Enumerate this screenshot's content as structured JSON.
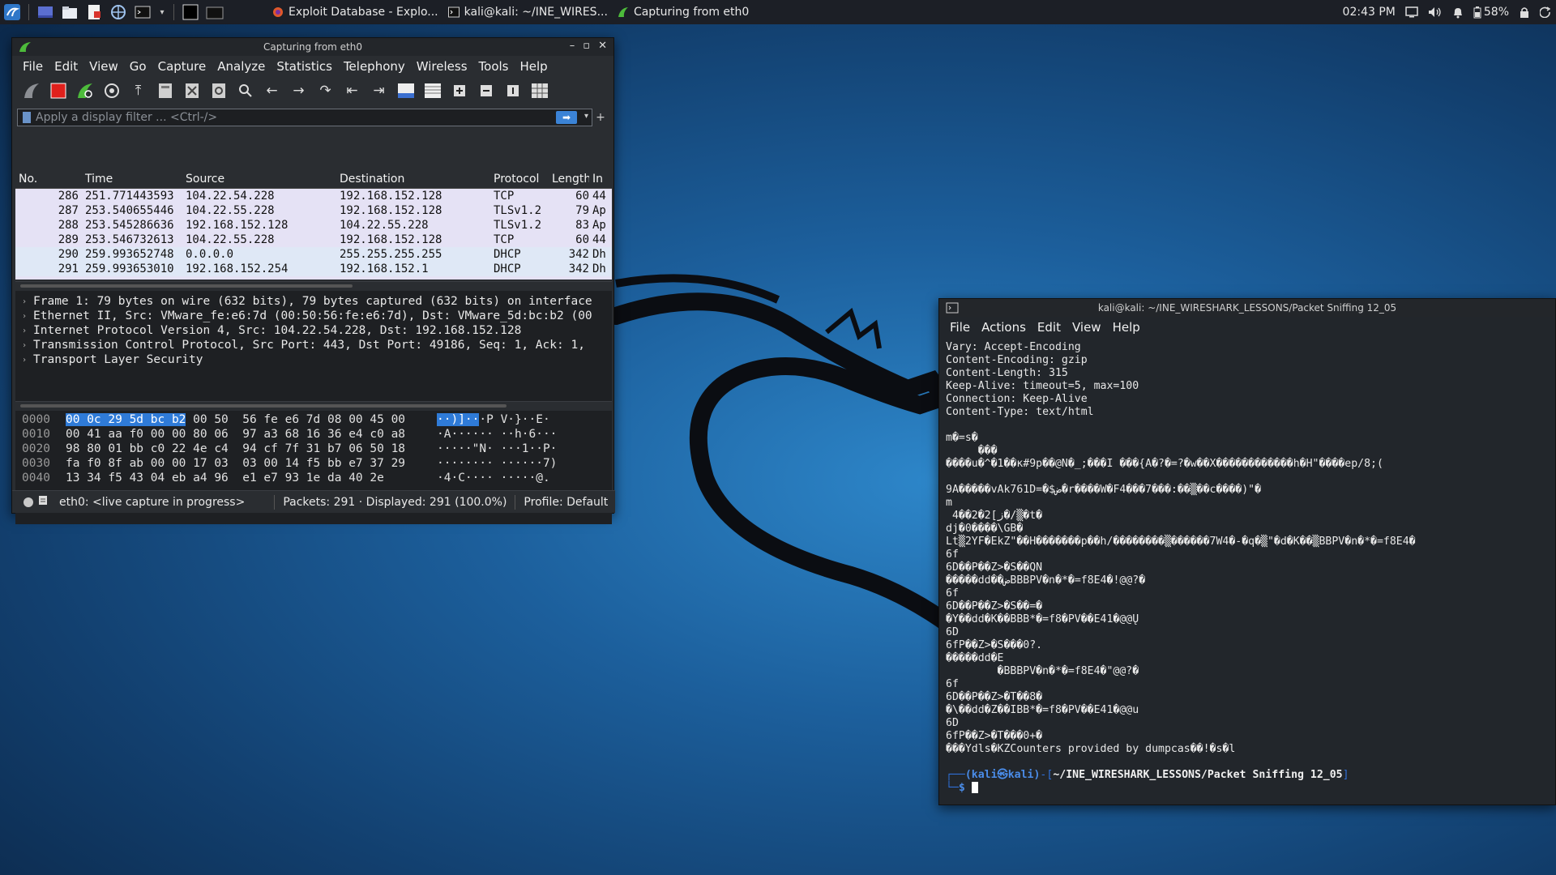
{
  "taskbar": {
    "tasks": [
      {
        "label": "Exploit Database - Explo...",
        "icon": "firefox-icon"
      },
      {
        "label": "kali@kali: ~/INE_WIRES...",
        "icon": "terminal-icon"
      },
      {
        "label": "Capturing from eth0",
        "icon": "wireshark-icon"
      }
    ],
    "clock": "02:43 PM",
    "battery": "58%"
  },
  "wireshark": {
    "title": "Capturing from eth0",
    "menu": [
      "File",
      "Edit",
      "View",
      "Go",
      "Capture",
      "Analyze",
      "Statistics",
      "Telephony",
      "Wireless",
      "Tools",
      "Help"
    ],
    "filter_placeholder": "Apply a display filter ... <Ctrl-/>",
    "columns": [
      "No.",
      "Time",
      "Source",
      "Destination",
      "Protocol",
      "Length",
      "In"
    ],
    "packets": [
      {
        "no": "286",
        "time": "251.771443593",
        "src": "104.22.54.228",
        "dst": "192.168.152.128",
        "proto": "TCP",
        "len": "60",
        "info": "44"
      },
      {
        "no": "287",
        "time": "253.540655446",
        "src": "104.22.55.228",
        "dst": "192.168.152.128",
        "proto": "TLSv1.2",
        "len": "79",
        "info": "Ap"
      },
      {
        "no": "288",
        "time": "253.545286636",
        "src": "192.168.152.128",
        "dst": "104.22.55.228",
        "proto": "TLSv1.2",
        "len": "83",
        "info": "Ap"
      },
      {
        "no": "289",
        "time": "253.546732613",
        "src": "104.22.55.228",
        "dst": "192.168.152.128",
        "proto": "TCP",
        "len": "60",
        "info": "44"
      },
      {
        "no": "290",
        "time": "259.993652748",
        "src": "0.0.0.0",
        "dst": "255.255.255.255",
        "proto": "DHCP",
        "len": "342",
        "info": "Dh"
      },
      {
        "no": "291",
        "time": "259.993653010",
        "src": "192.168.152.254",
        "dst": "192.168.152.1",
        "proto": "DHCP",
        "len": "342",
        "info": "Dh"
      }
    ],
    "details": [
      "Frame 1: 79 bytes on wire (632 bits), 79 bytes captured (632 bits) on interface",
      "Ethernet II, Src: VMware_fe:e6:7d (00:50:56:fe:e6:7d), Dst: VMware_5d:bc:b2 (00",
      "Internet Protocol Version 4, Src: 104.22.54.228, Dst: 192.168.152.128",
      "Transmission Control Protocol, Src Port: 443, Dst Port: 49186, Seq: 1, Ack: 1,",
      "Transport Layer Security"
    ],
    "bytes": [
      {
        "off": "0000",
        "hex_hl": "00 0c 29 5d bc b2",
        "hex": " 00 50  56 fe e6 7d 08 00 45 00",
        "asc_hl": "··)]··",
        "asc": "·P V·}··E·"
      },
      {
        "off": "0010",
        "hex_hl": "",
        "hex": "00 41 aa f0 00 00 80 06  97 a3 68 16 36 e4 c0 a8",
        "asc_hl": "",
        "asc": "·A······ ··h·6···"
      },
      {
        "off": "0020",
        "hex_hl": "",
        "hex": "98 80 01 bb c0 22 4e c4  94 cf 7f 31 b7 06 50 18",
        "asc_hl": "",
        "asc": "·····\"N· ···1··P·"
      },
      {
        "off": "0030",
        "hex_hl": "",
        "hex": "fa f0 8f ab 00 00 17 03  03 00 14 f5 bb e7 37 29",
        "asc_hl": "",
        "asc": "········ ······7)"
      },
      {
        "off": "0040",
        "hex_hl": "",
        "hex": "13 34 f5 43 04 eb a4 96  e1 e7 93 1e da 40 2e",
        "asc_hl": "",
        "asc": "·4·C···· ·····@."
      }
    ],
    "status": {
      "interface": "eth0: <live capture in progress>",
      "packets": "Packets: 291 · Displayed: 291 (100.0%)",
      "profile": "Profile: Default"
    }
  },
  "terminal": {
    "title": "kali@kali: ~/INE_WIRESHARK_LESSONS/Packet Sniffing 12_05",
    "menu": [
      "File",
      "Actions",
      "Edit",
      "View",
      "Help"
    ],
    "output": "Vary: Accept-Encoding\nContent-Encoding: gzip\nContent-Length: 315\nKeep-Alive: timeout=5, max=100\nConnection: Keep-Alive\nContent-Type: text/html\n\nm�=s�\n     ���\n����u�^�1��к#9p��@N�_;���I ���{A�?�=?�w��X������������h�H\"����ep/8;(\n\n9A�����vAk761D=�$ض�r����W�F4���7���:��▒��c����)\"�\nm\n 4��2�2[ز�/▒�t�\ndj�0����\\GB�\nLt▒2YF�EkZ\"��H�������p��h/��������▒������7W4�-�q�▒\"�d�K��▒BBPV�n�*�=f8E4�\n6f\n6D��P��Z>�S��QN\n�����dd��ضBBBPV�n�*�=f8E4�!@@?�\n6f\n6D��P��Z>�S��=�\n�Y��dd�K��BBB*�=f8�PV��E41�@@Ų\n6D\n6fP��Z>�S���0?.\n�����dd�E\n        �BBBPV�n�*�=f8E4�\"@@?�\n6f\n6D��P��Z>�T��8�\n�\\��dd�Z��IBB*�=f8�PV��E41�@@u\n6D\n6fP��Z>�T���0+�\n���Ydls�KZCounters provided by dumpcas��!�s�l",
    "prompt_user": "(kali㉿kali)",
    "prompt_path": "~/INE_WIRESHARK_LESSONS/Packet Sniffing 12_05"
  }
}
